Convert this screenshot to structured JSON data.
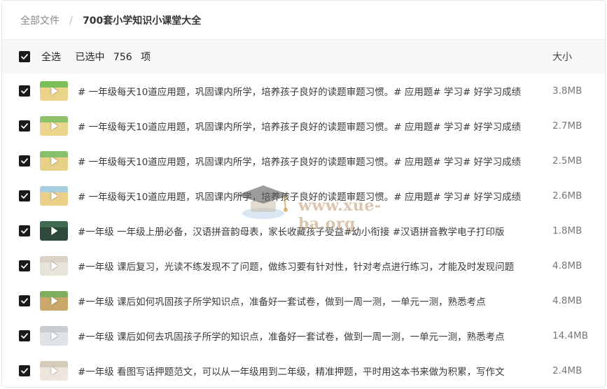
{
  "breadcrumb": {
    "root": "全部文件",
    "separator": "/",
    "current": "700套小学知识小课堂大全"
  },
  "list_header": {
    "select_all_label": "全选",
    "selected_prefix": "已选中",
    "selected_count": "756",
    "selected_suffix": "项",
    "size_column": "大小"
  },
  "files": [
    {
      "title": "# 一年级每天10道应用题，巩固课内所学，培养孩子良好的读题审题习惯。# 应用题# 学习# 好学习成绩",
      "size": "3.8MB",
      "thumb_color": "#e9d48a",
      "thumb_band": "#7bbf5a"
    },
    {
      "title": "# 一年级每天10道应用题，巩固课内所学，培养孩子良好的读题审题习惯。# 应用题# 学习# 好学习成绩",
      "size": "2.7MB",
      "thumb_color": "#ecd58c",
      "thumb_band": "#8cc26a"
    },
    {
      "title": "# 一年级每天10道应用题，巩固课内所学，培养孩子良好的读题审题习惯。# 应用题# 学习# 好学习成绩",
      "size": "2.5MB",
      "thumb_color": "#e7d08a",
      "thumb_band": "#87c06a"
    },
    {
      "title": "# 一年级每天10道应用题，巩固课内所学，培养孩子良好的读题审题习惯。# 应用题# 学习# 好学习成绩",
      "size": "2.6MB",
      "thumb_color": "#eccf88",
      "thumb_band": "#a7cfe0"
    },
    {
      "title": "#一年级 一年级上册必备，汉语拼音韵母表，家长收藏孩子受益#幼小衔接 #汉语拼音教学电子打印版",
      "size": "1.8MB",
      "thumb_color": "#2f4a3a",
      "thumb_band": "#3f6b52"
    },
    {
      "title": "#一年级 课后复习，光读不练发现不了问题，做练习要有针对性，针对考点进行练习，才能及时发现问题",
      "size": "4.8MB",
      "thumb_color": "#e8e3da",
      "thumb_band": "#d9d2c5"
    },
    {
      "title": "#一年级 课后如何巩固孩子所学知识点，准备好一套试卷，做到一周一测，一单元一测，熟悉考点",
      "size": "4.8MB",
      "thumb_color": "#c9a86a",
      "thumb_band": "#7fae5c"
    },
    {
      "title": "#一年级 课后如何去巩固孩子所学的知识点，准备好一套试卷，做到一周一测，一单元一测，熟悉考点",
      "size": "14.4MB",
      "thumb_color": "#dfe3e6",
      "thumb_band": "#c7ced3"
    },
    {
      "title": "#一年级 看图写话押题范文，可以从一年级用到二年级，精准押题，平时用这本书来做为积累，写作文",
      "size": "2.4MB",
      "thumb_color": "#ece6dc",
      "thumb_band": "#d6cbb8"
    }
  ],
  "watermark": {
    "text": "www.xue-ba.org",
    "icon": "graduation-cap-icon"
  },
  "colors": {
    "checkbox": "#1a1a1a",
    "header_bg": "#f6f7f9",
    "border": "#e6e6e6"
  }
}
